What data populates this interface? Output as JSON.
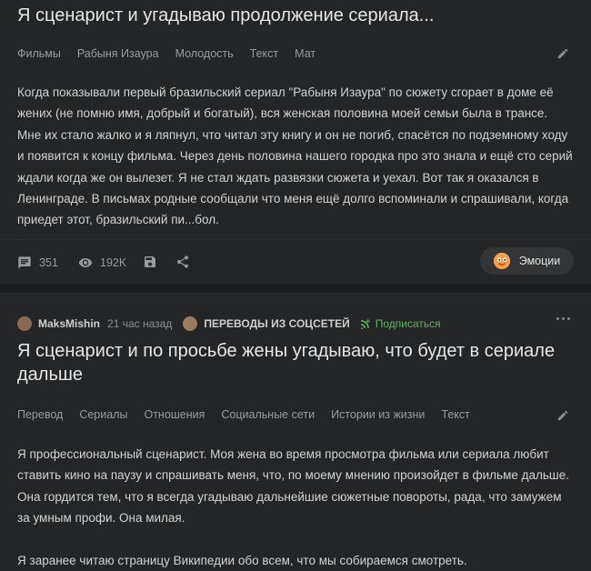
{
  "post1": {
    "title": "Я сценарист и угадываю продолжение сериала...",
    "tags": [
      "Фильмы",
      "Рабыня Изаура",
      "Молодость",
      "Текст",
      "Мат"
    ],
    "body": "Когда показывали первый бразильский сериал \"Рабыня Изаура\" по сюжету сгорает в доме её жених (не помню имя, добрый и богатый), вся женская половина моей семьи была в трансе. Мне их стало жалко и я ляпнул, что читал эту книгу и он не погиб, спасётся по подземному ходу и появится к концу фильма. Через день половина нашего городка про это знала и ещё сто серий ждали когда же он вылезет. Я не стал ждать развязки сюжета и уехал. Вот так я оказался в Ленинграде. В письмах родные сообщали что меня ещё долго вспоминали и спрашивали, когда приедет этот, бразильский пи...бол.",
    "comments": "351",
    "views": "192K",
    "emotions_label": "Эмоции"
  },
  "post2": {
    "author": "MaksMishin",
    "time": "21 час назад",
    "community": "ПЕРЕВОДЫ ИЗ СОЦСЕТЕЙ",
    "subscribe": "Подписаться",
    "title": "Я сценарист и по просьбе жены угадываю, что будет в сериале дальше",
    "tags": [
      "Перевод",
      "Сериалы",
      "Отношения",
      "Социальные сети",
      "Истории из жизни",
      "Текст"
    ],
    "p1": "Я профессиональный сценарист. Моя жена во время просмотра фильма или сериала любит ставить кино на паузу и спрашивать меня, что, по моему мнению произойдет в фильме дальше. Она гордится тем, что я всегда угадываю дальнейшие сюжетные повороты, рада, что замужем за умным профи. Она милая.",
    "p2": "Я заранее читаю страницу Википедии обо всем, что мы собираемся смотреть."
  },
  "icons": {
    "edit": "pencil-icon",
    "comments": "comment-icon",
    "views": "eye-icon",
    "save": "save-icon",
    "share": "share-icon",
    "emotions": "emoji-icon",
    "subscribe": "subscribe-icon",
    "more": "more-dots-icon"
  },
  "colors": {
    "background": "#242526",
    "subscribe": "#5ab55e",
    "emoji": "#f59e50"
  }
}
